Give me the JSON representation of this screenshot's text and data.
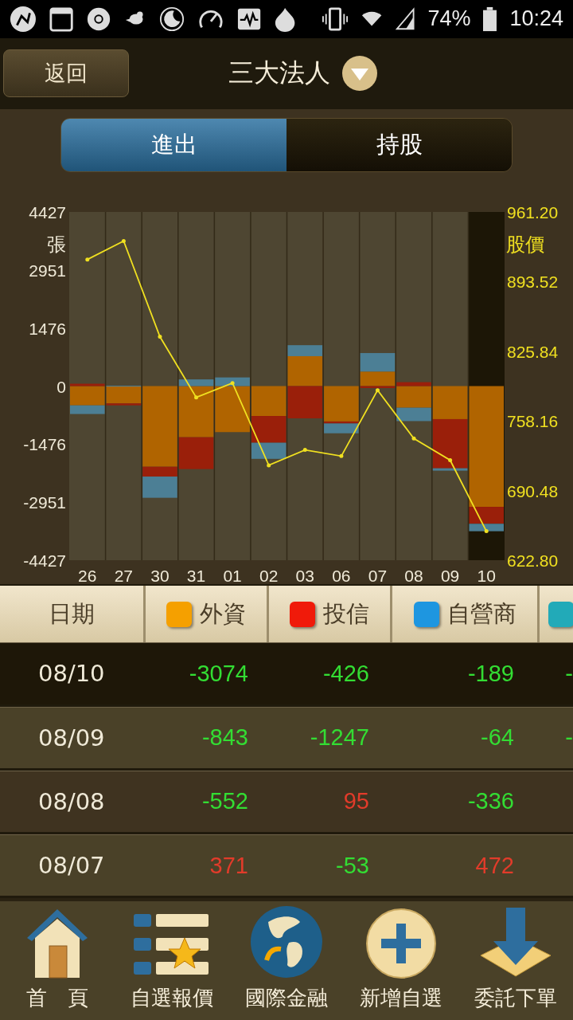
{
  "status_bar": {
    "battery": "74%",
    "time": "10:24"
  },
  "header": {
    "back_button": "返回",
    "title": "三大法人"
  },
  "tabs": [
    {
      "label": "進出",
      "selected": true
    },
    {
      "label": "持股",
      "selected": false
    }
  ],
  "chart": {
    "category_selected": [
      false,
      false,
      false,
      false,
      false,
      false,
      false,
      false,
      false,
      false,
      false,
      true
    ],
    "chart_data": {
      "type": "bar",
      "stacked": true,
      "ylabel": "張",
      "categories": [
        "26",
        "27",
        "30",
        "31",
        "01",
        "02",
        "03",
        "06",
        "07",
        "08",
        "09",
        "10"
      ],
      "ylim": [
        -4427,
        4427
      ],
      "yticks": [
        4427,
        2951,
        1476,
        0,
        -1476,
        -2951,
        -4427
      ],
      "series": [
        {
          "color": "#b06400",
          "values": [
            -490,
            -440,
            -2050,
            -1300,
            -1170,
            -760,
            760,
            -900,
            370,
            -550,
            -840,
            -3070
          ]
        },
        {
          "color": "#9a1f0a",
          "values": [
            60,
            -50,
            -250,
            -810,
            0,
            -680,
            -820,
            -50,
            -50,
            100,
            -1250,
            -430
          ]
        },
        {
          "color": "#4c7f95",
          "values": [
            -220,
            10,
            -540,
            170,
            220,
            -410,
            280,
            -250,
            470,
            -340,
            -60,
            -190
          ]
        }
      ]
    }
  },
  "price_chart": {
    "chart_data": {
      "type": "line",
      "ylabel": "股價",
      "ylim": [
        622.8,
        961.2
      ],
      "yticks": [
        {
          "value": 961.2,
          "label": "961.20"
        },
        {
          "value": 893.52,
          "label": "893.52"
        },
        {
          "value": 825.84,
          "label": "825.84"
        },
        {
          "value": 758.16,
          "label": "758.16"
        },
        {
          "value": 690.48,
          "label": "690.48"
        },
        {
          "value": 622.8,
          "label": "622.80"
        }
      ],
      "series": [
        {
          "color": "#f0e020",
          "values": [
            915,
            933,
            840,
            781,
            795,
            715,
            730,
            724,
            788,
            741,
            720,
            651
          ]
        }
      ]
    }
  },
  "table": {
    "columns": [
      {
        "label": "日期"
      },
      {
        "label": "外資",
        "color": "#f5a000"
      },
      {
        "label": "投信",
        "color": "#f01a0a"
      },
      {
        "label": "自營商",
        "color": "#1e96e0"
      },
      {
        "color": "#22aab8"
      }
    ],
    "rows": [
      {
        "selected": true,
        "cells": [
          {
            "text": "08/10"
          },
          {
            "text": "-3074",
            "color": "#33dd33"
          },
          {
            "text": "-426",
            "color": "#33dd33"
          },
          {
            "text": "-189",
            "color": "#33dd33"
          },
          {
            "text": "-",
            "color": "#33dd33"
          }
        ]
      },
      {
        "selected": false,
        "cells": [
          {
            "text": "08/09"
          },
          {
            "text": "-843",
            "color": "#33dd33"
          },
          {
            "text": "-1247",
            "color": "#33dd33"
          },
          {
            "text": "-64",
            "color": "#33dd33"
          },
          {
            "text": "-",
            "color": "#33dd33"
          }
        ]
      },
      {
        "selected": false,
        "cells": [
          {
            "text": "08/08"
          },
          {
            "text": "-552",
            "color": "#33dd33"
          },
          {
            "text": "95",
            "color": "#e23b2a"
          },
          {
            "text": "-336",
            "color": "#33dd33"
          }
        ]
      },
      {
        "selected": false,
        "cells": [
          {
            "text": "08/07"
          },
          {
            "text": "371",
            "color": "#e23b2a"
          },
          {
            "text": "-53",
            "color": "#33dd33"
          },
          {
            "text": "472",
            "color": "#e23b2a"
          }
        ]
      }
    ]
  },
  "bottom_nav": [
    {
      "kind": "home",
      "label": "首　頁"
    },
    {
      "kind": "watchlist",
      "label": "自選報價"
    },
    {
      "kind": "globe",
      "label": "國際金融"
    },
    {
      "kind": "add",
      "label": "新增自選"
    },
    {
      "kind": "order",
      "label": "委託下單"
    }
  ]
}
